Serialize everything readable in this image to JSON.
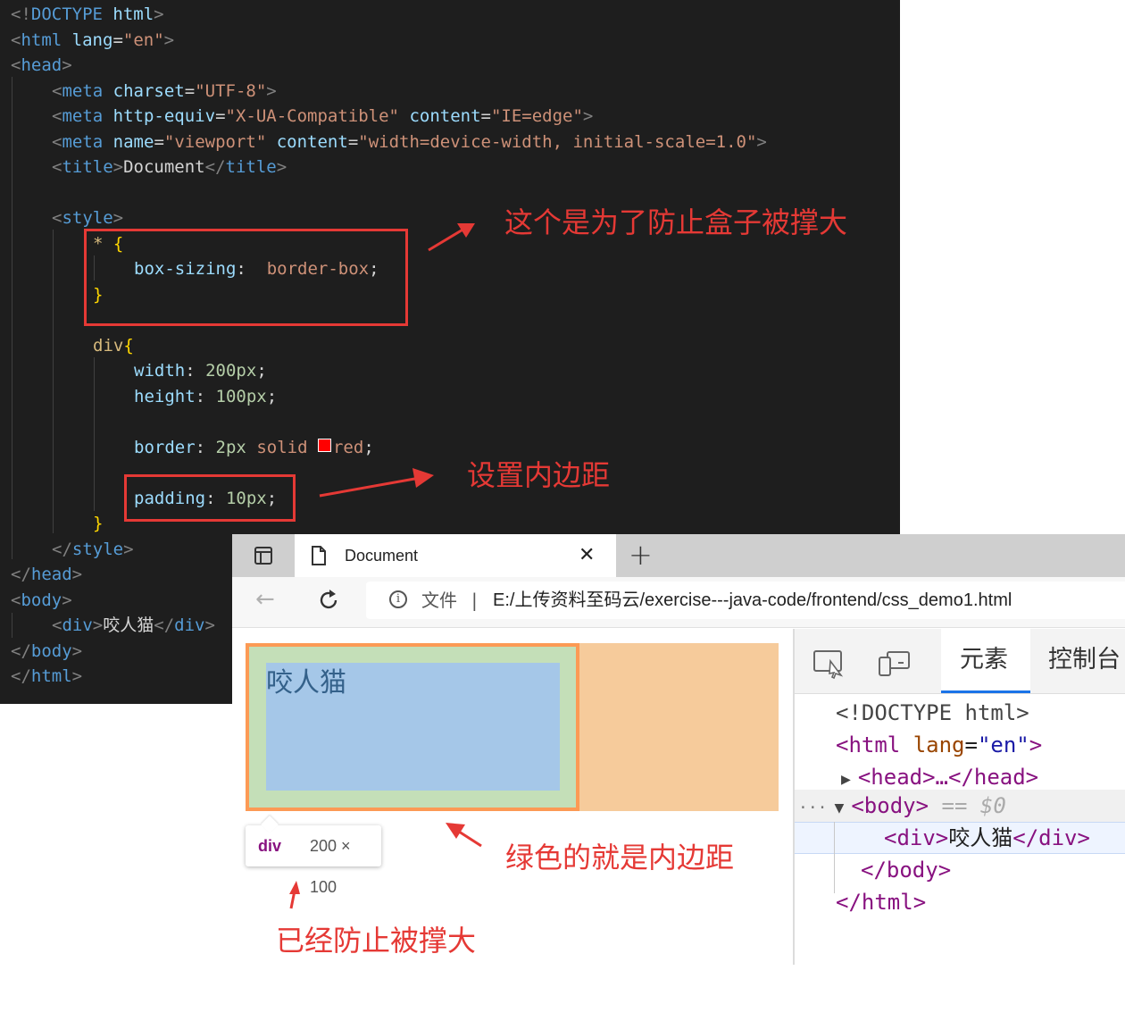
{
  "editor": {
    "lines": {
      "l1": {
        "bracket_open": "<!",
        "tag": "DOCTYPE",
        "rest": " html",
        "bracket_close": ">"
      },
      "l2": {
        "tag": "html",
        "attr": "lang",
        "value": "\"en\""
      },
      "l3": {
        "tag": "head"
      },
      "l4": {
        "tag": "meta",
        "attr": "charset",
        "value": "\"UTF-8\""
      },
      "l5": {
        "tag": "meta",
        "attr1": "http-equiv",
        "value1": "\"X-UA-Compatible\"",
        "attr2": "content",
        "value2": "\"IE=edge\""
      },
      "l6": {
        "tag": "meta",
        "attr1": "name",
        "value1": "\"viewport\"",
        "attr2": "content",
        "value2": "\"width=device-width, initial-scale=1.0\""
      },
      "l7": {
        "tag": "title",
        "text": "Document"
      },
      "l8": {
        "tag": "style"
      },
      "l9": {
        "selector": "*",
        "brace": "{"
      },
      "l10": {
        "prop": "box-sizing",
        "value": "border-box"
      },
      "l11": {
        "brace": "}"
      },
      "l12": {
        "selector": "div",
        "brace": "{"
      },
      "l13": {
        "prop": "width",
        "value": "200px"
      },
      "l14": {
        "prop": "height",
        "value": "100px"
      },
      "l15": {
        "prop": "border",
        "value_num": "2px",
        "value_kw": "solid",
        "value_color": "red"
      },
      "l16": {
        "prop": "padding",
        "value": "10px"
      },
      "l17": {
        "brace": "}"
      },
      "l18": {
        "tag": "style"
      },
      "l19": {
        "tag": "head"
      },
      "l20": {
        "tag": "body"
      },
      "l21": {
        "tag": "div",
        "text": "咬人猫"
      },
      "l22": {
        "tag": "body"
      },
      "l23": {
        "tag": "html"
      }
    },
    "punct": {
      "colon": ":",
      "semicolon": ";",
      "equals": "="
    }
  },
  "annotations": {
    "box_sizing_note": "这个是为了防止盒子被撑大",
    "padding_note": "设置内边距",
    "green_note": "绿色的就是内边距",
    "prevent_note": "已经防止被撑大"
  },
  "browser": {
    "tab_title": "Document",
    "tab_close": "✕",
    "new_tab": "+",
    "back": "←",
    "info": "i",
    "address_label": "文件",
    "address_sep": "|",
    "url": "E:/上传资料至码云/exercise---java-code/frontend/css_demo1.html",
    "page_div_text": "咬人猫",
    "tooltip": {
      "tag": "div",
      "size": "200 × 100"
    }
  },
  "devtools": {
    "tab_elements": "元素",
    "tab_console": "控制台",
    "dom": {
      "doctype": "<!DOCTYPE html>",
      "html_open_tag": "<html",
      "html_lang_attr": "lang",
      "html_lang_value": "\"en\"",
      "head_collapsed": "<head>…</head>",
      "body_open": "<body>",
      "selected_marker": "== $0",
      "ellipsis": "···",
      "div_open": "<div>",
      "div_text": "咬人猫",
      "div_close": "</div>",
      "body_close": "</body>",
      "html_close": "</html>"
    }
  },
  "colors": {
    "annotation_red": "#e53935",
    "margin_orange": "#f6cb9b",
    "border_orange": "#fc9a55",
    "padding_green": "#c4dfb8",
    "content_blue": "#a5c7e8",
    "editor_bg": "#1e1e1e"
  }
}
